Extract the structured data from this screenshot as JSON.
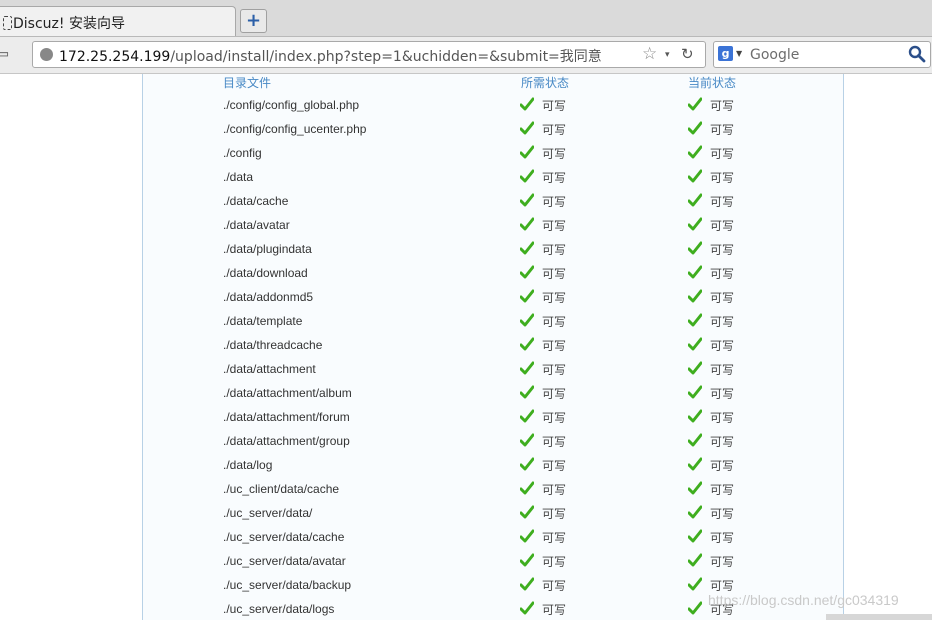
{
  "browser": {
    "tab_title": "Discuz! 安装向导",
    "new_tab_label": "+",
    "url_host": "172.25.254.199",
    "url_path": "/upload/install/index.php?step=1&uchidden=&submit=我同意",
    "search_engine_letter": "g",
    "search_placeholder": "Google"
  },
  "table": {
    "headers": {
      "directory": "目录文件",
      "required": "所需状态",
      "current": "当前状态"
    },
    "rows": [
      {
        "path": "./config/config_global.php",
        "required": "可写",
        "current": "可写"
      },
      {
        "path": "./config/config_ucenter.php",
        "required": "可写",
        "current": "可写"
      },
      {
        "path": "./config",
        "required": "可写",
        "current": "可写"
      },
      {
        "path": "./data",
        "required": "可写",
        "current": "可写"
      },
      {
        "path": "./data/cache",
        "required": "可写",
        "current": "可写"
      },
      {
        "path": "./data/avatar",
        "required": "可写",
        "current": "可写"
      },
      {
        "path": "./data/plugindata",
        "required": "可写",
        "current": "可写"
      },
      {
        "path": "./data/download",
        "required": "可写",
        "current": "可写"
      },
      {
        "path": "./data/addonmd5",
        "required": "可写",
        "current": "可写"
      },
      {
        "path": "./data/template",
        "required": "可写",
        "current": "可写"
      },
      {
        "path": "./data/threadcache",
        "required": "可写",
        "current": "可写"
      },
      {
        "path": "./data/attachment",
        "required": "可写",
        "current": "可写"
      },
      {
        "path": "./data/attachment/album",
        "required": "可写",
        "current": "可写"
      },
      {
        "path": "./data/attachment/forum",
        "required": "可写",
        "current": "可写"
      },
      {
        "path": "./data/attachment/group",
        "required": "可写",
        "current": "可写"
      },
      {
        "path": "./data/log",
        "required": "可写",
        "current": "可写"
      },
      {
        "path": "./uc_client/data/cache",
        "required": "可写",
        "current": "可写"
      },
      {
        "path": "./uc_server/data/",
        "required": "可写",
        "current": "可写"
      },
      {
        "path": "./uc_server/data/cache",
        "required": "可写",
        "current": "可写"
      },
      {
        "path": "./uc_server/data/avatar",
        "required": "可写",
        "current": "可写"
      },
      {
        "path": "./uc_server/data/backup",
        "required": "可写",
        "current": "可写"
      },
      {
        "path": "./uc_server/data/logs",
        "required": "可写",
        "current": "可写"
      }
    ]
  },
  "watermark": "https://blog.csdn.net/gc034319",
  "colors": {
    "check": "#3fae1f",
    "header_text": "#4889c5",
    "panel_border": "#b8d1e6"
  },
  "icons": {
    "status": "check-icon",
    "search": "magnifier-icon",
    "bookmark": "star-icon",
    "reload": "reload-icon"
  }
}
